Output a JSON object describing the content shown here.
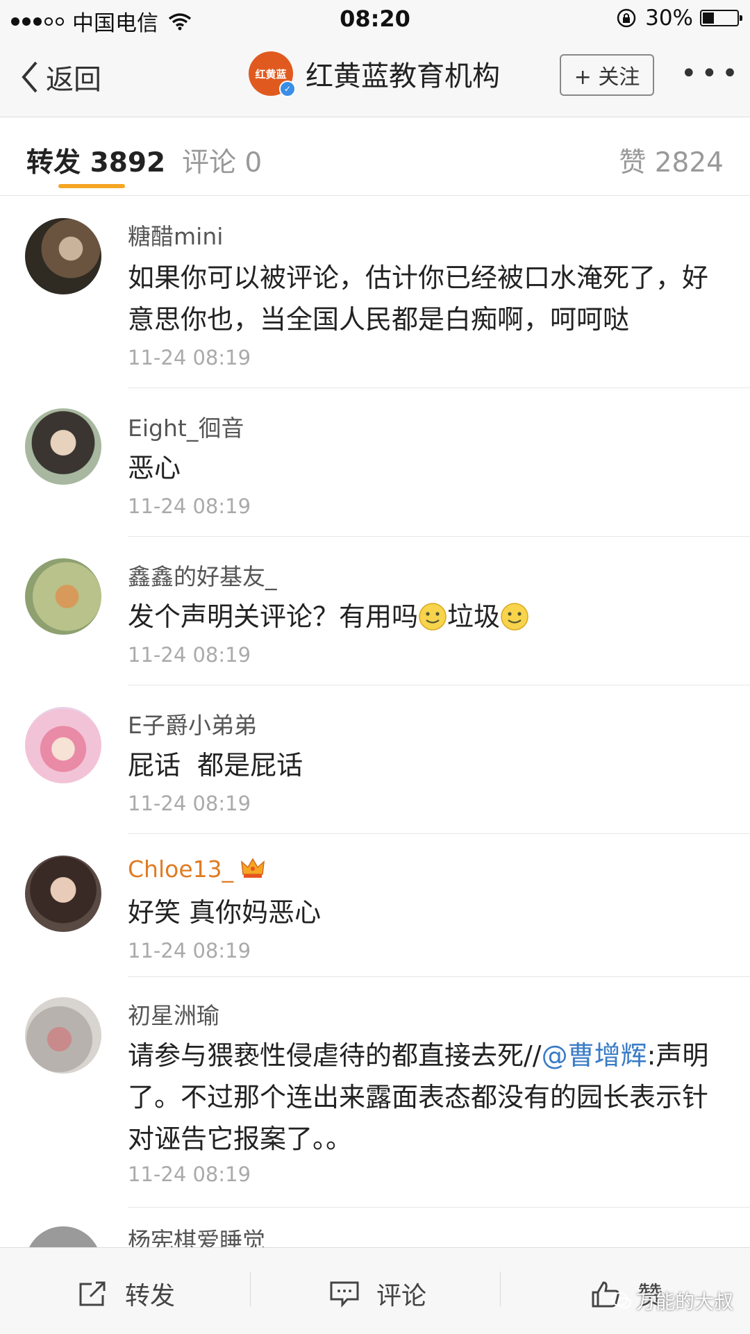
{
  "status_bar": {
    "carrier": "中国电信",
    "time": "08:20",
    "battery": "30%"
  },
  "nav": {
    "back_label": "返回",
    "title": "红黄蓝教育机构",
    "logo_text": "红黄蓝",
    "follow_label": "+ 关注",
    "more_label": "•••"
  },
  "tabs": {
    "repost": "转发 3892",
    "comment": "评论 0",
    "like": "赞 2824"
  },
  "comments": [
    {
      "user": "糖醋mini",
      "text": "如果你可以被评论，估计你已经被口水淹死了，好意思你也，当全国人民都是白痴啊，呵呵哒",
      "time": "11-24 08:19"
    },
    {
      "user": "Eight_徊音",
      "text": "恶心",
      "time": "11-24 08:19"
    },
    {
      "user": "鑫鑫的好基友_",
      "text_a": "发个声明关评论？有用吗",
      "text_b": "垃圾",
      "time": "11-24 08:19"
    },
    {
      "user": "E子爵小弟弟",
      "text": "屁话  都是屁话",
      "time": "11-24 08:19"
    },
    {
      "user": "Chloe13_",
      "text": "好笑 真你妈恶心",
      "time": "11-24 08:19"
    },
    {
      "user": "初星洲瑜",
      "text_a": "请参与猥亵性侵虐待的都直接去死//",
      "mention": "@曹增辉",
      "text_b": ":声明了。不过那个连出来露面表态都没有的园长表示针对诬告它报案了。。",
      "time": "11-24 08:19"
    },
    {
      "user": "杨宪棋爱睡觉"
    }
  ],
  "bottom_bar": {
    "repost": "转发",
    "comment": "评论",
    "like": "赞"
  },
  "watermark": "万能的大叔",
  "colors": {
    "accent_underline": "#f5a623",
    "vip_name": "#e07b22",
    "mention": "#3a7cc7"
  }
}
